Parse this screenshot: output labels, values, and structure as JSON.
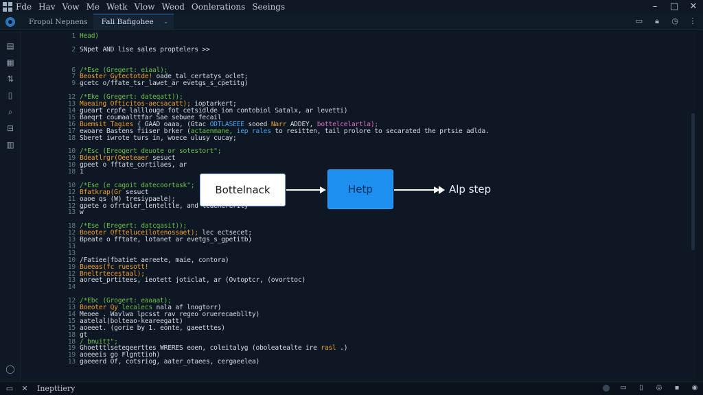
{
  "menu": [
    "Fde",
    "Hav",
    "Vow",
    "Me",
    "Wetk",
    "Vlow",
    "Weod",
    "Oonlerations",
    "Seeings"
  ],
  "tabs": [
    {
      "label": "Fropol Nepnens",
      "active": false
    },
    {
      "label": "Fali Bafigohee",
      "active": true
    }
  ],
  "code_lines": [
    {
      "ln": "1",
      "tokens": [
        {
          "t": "Head)",
          "c": "green"
        }
      ]
    },
    {
      "ln": "",
      "tokens": []
    },
    {
      "ln": "2",
      "tokens": [
        {
          "t": "SNpet AND lise sales proptelers  >>",
          "c": "plain"
        }
      ]
    },
    {
      "ln": "",
      "tokens": []
    },
    {
      "ln": "",
      "tokens": []
    },
    {
      "ln": "6",
      "tokens": [
        {
          "t": "/*Ese (Gregert: eiaal);",
          "c": "green"
        }
      ]
    },
    {
      "ln": "7",
      "tokens": [
        {
          "t": "Beoster Gytectotde!",
          "c": "orange"
        },
        {
          "t": " oade_tal_certatys_oclet;",
          "c": "plain"
        }
      ]
    },
    {
      "ln": "9",
      "tokens": [
        {
          "t": "gcetc o/ffate_tsr_lawet_ar evetgs_s_cpetitg)",
          "c": "plain"
        }
      ]
    },
    {
      "ln": "",
      "tokens": []
    },
    {
      "ln": "12",
      "tokens": [
        {
          "t": "/*Eke (Gregert: dateqatt));",
          "c": "green"
        }
      ]
    },
    {
      "ln": "13",
      "tokens": [
        {
          "t": "Maeaing Ofticitos-aecsacatt);",
          "c": "orange"
        },
        {
          "t": " ioptarkert;",
          "c": "plain"
        }
      ]
    },
    {
      "ln": "14",
      "tokens": [
        {
          "t": "gueart crpfe lalllouge fot cetsidlde ion contobiol Satalx, ar levetti)",
          "c": "plain"
        }
      ]
    },
    {
      "ln": "15",
      "tokens": [
        {
          "t": "Baeqrt coumaalttfar Sae sebuee fecail",
          "c": "plain"
        }
      ]
    },
    {
      "ln": "16",
      "tokens": [
        {
          "t": "Buemsit Tagies",
          "c": "orange"
        },
        {
          "t": " { GAAD oaaa, (Gtac ",
          "c": "plain"
        },
        {
          "t": "ODTLASEEE",
          "c": "blue"
        },
        {
          "t": " sooed ",
          "c": "plain"
        },
        {
          "t": "Narr",
          "c": "orange"
        },
        {
          "t": " ADDEY, ",
          "c": "plain"
        },
        {
          "t": "bottelcelartla);",
          "c": "pink"
        }
      ]
    },
    {
      "ln": "17",
      "tokens": [
        {
          "t": "ewoare Bastens fiiser brker (",
          "c": "plain"
        },
        {
          "t": "actaenmane,",
          "c": "green"
        },
        {
          "t": " ",
          "c": "plain"
        },
        {
          "t": "iep rales",
          "c": "blue"
        },
        {
          "t": " to resitten, tail prolore to secarated the prtsie adlda.",
          "c": "plain"
        }
      ]
    },
    {
      "ln": "18",
      "tokens": [
        {
          "t": "Sberet iwrote turs in, woece ulusy cucay;",
          "c": "plain"
        }
      ]
    },
    {
      "ln": "",
      "tokens": []
    },
    {
      "ln": "10",
      "tokens": [
        {
          "t": "/*Esc (Ereogert deuote or sotestort\";",
          "c": "green"
        }
      ]
    },
    {
      "ln": "19",
      "tokens": [
        {
          "t": "Bdeatlrgr(Oeeteaer ",
          "c": "orange"
        },
        {
          "t": "sesuct",
          "c": "plain"
        }
      ]
    },
    {
      "ln": "10",
      "tokens": [
        {
          "t": "gpeet o fftate_cortilaes, ar",
          "c": "plain"
        }
      ]
    },
    {
      "ln": "18",
      "tokens": [
        {
          "t": "1",
          "c": "plain"
        }
      ]
    },
    {
      "ln": "",
      "tokens": []
    },
    {
      "ln": "10",
      "tokens": [
        {
          "t": "/*Ese (e cagoit datecoortask\";",
          "c": "green"
        }
      ]
    },
    {
      "ln": "12",
      "tokens": [
        {
          "t": "Bfatkrap(Gr ",
          "c": "orange"
        },
        {
          "t": "sesuct",
          "c": "plain"
        }
      ]
    },
    {
      "ln": "11",
      "tokens": [
        {
          "t": "oaoe qs (W) tresiypaele);",
          "c": "plain"
        }
      ]
    },
    {
      "ln": "12",
      "tokens": [
        {
          "t": "gpete o ofrtaler_lenteltle, and ledenererity",
          "c": "plain"
        }
      ]
    },
    {
      "ln": "13",
      "tokens": [
        {
          "t": "w",
          "c": "plain"
        }
      ]
    },
    {
      "ln": "",
      "tokens": []
    },
    {
      "ln": "18",
      "tokens": [
        {
          "t": "/*Ese (Eregert: datcqasit));",
          "c": "green"
        }
      ]
    },
    {
      "ln": "12",
      "tokens": [
        {
          "t": "Boeoter Oftteluceilotenossaet);",
          "c": "orange"
        },
        {
          "t": " lec ectsecet;",
          "c": "plain"
        }
      ]
    },
    {
      "ln": "13",
      "tokens": [
        {
          "t": "Bpeate o fftate, lotanet ar evetgs_s_gpetitb)",
          "c": "plain"
        }
      ]
    },
    {
      "ln": "13",
      "tokens": [
        {
          "t": "",
          "c": "plain"
        }
      ]
    },
    {
      "ln": "13",
      "tokens": [
        {
          "t": "",
          "c": "plain"
        }
      ]
    },
    {
      "ln": "10",
      "tokens": [
        {
          "t": "/Fatiee(fbatiet aereete, maie, contora)",
          "c": "plain"
        }
      ]
    },
    {
      "ln": "19",
      "tokens": [
        {
          "t": "Bueeas(fc ruesott!",
          "c": "orange"
        }
      ]
    },
    {
      "ln": "12",
      "tokens": [
        {
          "t": "Bneltrtecestaal);",
          "c": "orange"
        }
      ]
    },
    {
      "ln": "13",
      "tokens": [
        {
          "t": "aoreet_prtitees, ieotett joticlat, ar (Ovtoptcr, (ovorttoc)",
          "c": "plain"
        }
      ]
    },
    {
      "ln": "14",
      "tokens": [
        {
          "t": "",
          "c": "plain"
        }
      ]
    },
    {
      "ln": "",
      "tokens": []
    },
    {
      "ln": "12",
      "tokens": [
        {
          "t": "/*Ebc (Grogert: eaaaat);",
          "c": "green"
        }
      ]
    },
    {
      "ln": "13",
      "tokens": [
        {
          "t": "Boeoter Qy ",
          "c": "orange"
        },
        {
          "t": "lecalecs",
          "c": "green"
        },
        {
          "t": " nala af lnogtorr)",
          "c": "plain"
        }
      ]
    },
    {
      "ln": "14",
      "tokens": [
        {
          "t": "Meoee . Wavlwa lpcsst rav regeo oruerecaebllty)",
          "c": "plain"
        }
      ]
    },
    {
      "ln": "15",
      "tokens": [
        {
          "t": "aatelal(bolteao-keareegatt)",
          "c": "plain"
        }
      ]
    },
    {
      "ln": "15",
      "tokens": [
        {
          "t": "aoeeet. (gorie by 1. eonte, gaeetttes)",
          "c": "plain"
        }
      ]
    },
    {
      "ln": "18",
      "tokens": [
        {
          "t": "gt",
          "c": "plain"
        }
      ]
    },
    {
      "ln": "18",
      "tokens": [
        {
          "t": "/ bnuitt\";",
          "c": "green"
        }
      ]
    },
    {
      "ln": "19",
      "tokens": [
        {
          "t": "Ghoetttlseteqeerttes WRERES eoen, coleitalyg (oboleatealte ire ",
          "c": "plain"
        },
        {
          "t": "rasl",
          "c": "orange"
        },
        {
          "t": " .)",
          "c": "plain"
        }
      ]
    },
    {
      "ln": "19",
      "tokens": [
        {
          "t": "aoeeeis go Flgnttioh)",
          "c": "plain"
        }
      ]
    },
    {
      "ln": "13",
      "tokens": [
        {
          "t": "gaeeerd Of, cotsriog, aater_otaees, cergaeelea)",
          "c": "plain"
        }
      ]
    }
  ],
  "diagram": {
    "box1": "Bottelnack",
    "box2": "Hetp",
    "step": "Alp step"
  },
  "status": {
    "text": "Inepttiery"
  },
  "colors": {
    "background": "#0d1520",
    "accent": "#1e8ef0",
    "keyword": "#f0a030",
    "comment": "#6cc04a"
  }
}
